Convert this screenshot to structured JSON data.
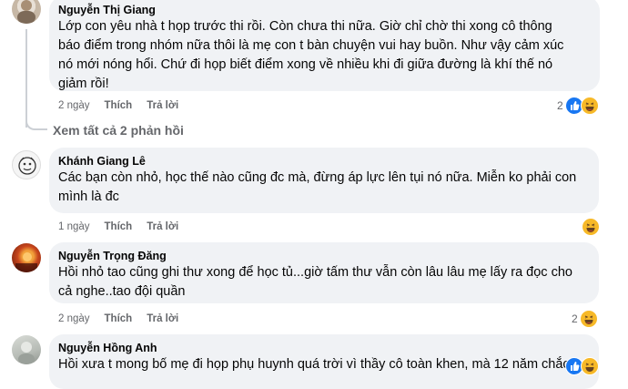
{
  "comments": [
    {
      "author": "Nguyễn Thị Giang",
      "text": "Lớp con yêu nhà t họp trước thi rồi. Còn chưa thi nữa. Giờ chỉ chờ thi xong cô thông\nbáo điểm trong nhóm nữa thôi là mẹ con t bàn chuyện vui hay buồn. Như vậy cảm xúc\nnó mới nóng hổi. Chứ đi họp biết điểm xong về nhiều khi đi giữa đường là khí thế nó\ngiảm rồi!",
      "time": "2 ngày",
      "like": "Thích",
      "reply": "Trả lời",
      "reaction_count": "2",
      "reactions": [
        "like-icon",
        "haha-icon"
      ]
    },
    {
      "author": "Khánh Giang Lê",
      "text": "Các bạn còn nhỏ, học thế nào cũng đc mà, đừng áp lực lên tụi nó nữa. Miễn ko phải con\nmình là đc",
      "time": "1 ngày",
      "like": "Thích",
      "reply": "Trả lời",
      "reaction_count": "",
      "reactions": [
        "haha-icon"
      ]
    },
    {
      "author": "Nguyễn Trọng Đăng",
      "text": "Hồi nhỏ tao cũng ghi thư xong để học tủ...giờ tấm thư vẫn còn lâu lâu mẹ lấy ra đọc cho\ncả nghe..tao đội quần",
      "time": "2 ngày",
      "like": "Thích",
      "reply": "Trả lời",
      "reaction_count": "2",
      "reactions": [
        "haha-icon"
      ]
    },
    {
      "author": "Nguyễn Hồng Anh",
      "text": "Hồi xưa t mong bố mẹ đi họp phụ huynh quá trời vì thầy cô toàn khen, mà 12 năm chắc",
      "time": "",
      "like": "",
      "reply": "",
      "reaction_count": "",
      "reactions": [
        "like-icon",
        "haha-icon"
      ]
    }
  ],
  "view_replies": "Xem tất cả 2 phản hồi",
  "colors": {
    "bubble": "#f0f2f5",
    "meta": "#65676b",
    "like_blue": "#1877f2",
    "haha_yellow": "#f7b928"
  }
}
